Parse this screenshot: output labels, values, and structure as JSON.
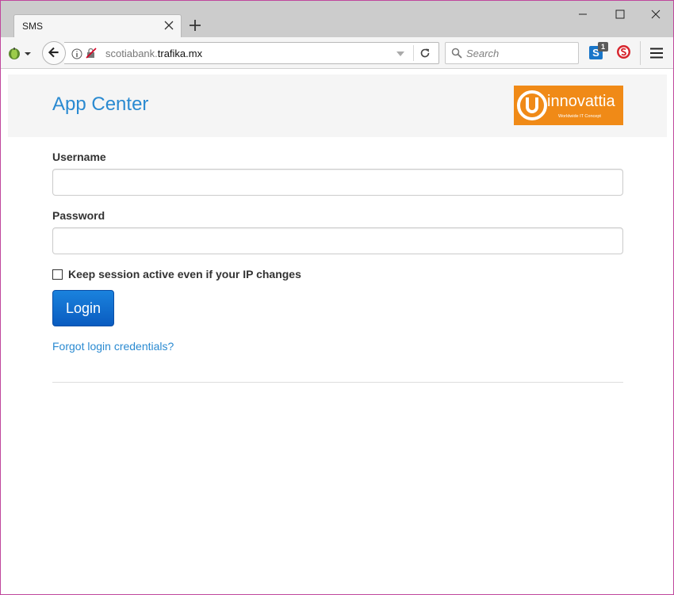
{
  "browser": {
    "tab": {
      "title": "SMS"
    },
    "url": {
      "prefix": "scotiabank.",
      "host": "trafika.mx"
    },
    "search": {
      "placeholder": "Search"
    },
    "extensions": {
      "badge_count": "1",
      "s_letter": "S"
    },
    "icons": {
      "tab_close": "close-icon",
      "new_tab": "plus-icon",
      "minimize": "minimize-icon",
      "maximize": "maximize-icon",
      "close": "close-icon",
      "back": "back-arrow-icon",
      "info": "info-icon",
      "insecure": "insecure-lock-icon",
      "reload": "reload-icon",
      "search": "search-icon",
      "menu": "hamburger-menu-icon"
    }
  },
  "page": {
    "header": {
      "title": "App Center",
      "logo": {
        "word": "innovattia",
        "tagline": "Worldwide IT Concept"
      }
    },
    "form": {
      "username_label": "Username",
      "username_value": "",
      "password_label": "Password",
      "password_value": "",
      "keep_session_label": "Keep session active even if your IP changes",
      "keep_session_checked": false,
      "login_label": "Login",
      "forgot_link": "Forgot login credentials?"
    }
  },
  "colors": {
    "accent": "#2a8ad1",
    "button": "#0a5cc0",
    "logo_bg": "#f08a17",
    "window_border": "#c0479d"
  }
}
